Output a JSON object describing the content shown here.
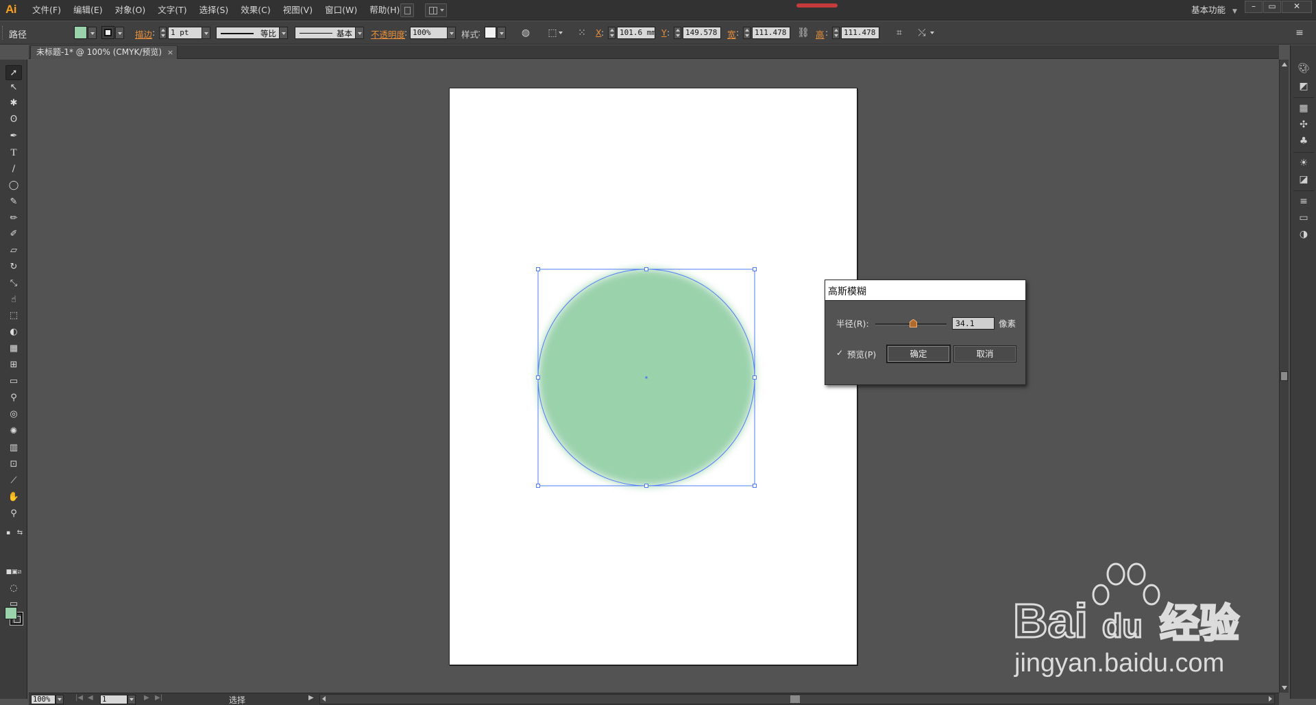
{
  "app": {
    "logo": "Ai"
  },
  "menu": [
    "文件(F)",
    "编辑(E)",
    "对象(O)",
    "文字(T)",
    "选择(S)",
    "效果(C)",
    "视图(V)",
    "窗口(W)",
    "帮助(H)"
  ],
  "workspace": "基本功能",
  "window_controls": {
    "min": "–",
    "max": "▭",
    "close": "✕"
  },
  "control_bar": {
    "selection_type": "路径",
    "stroke_label": "描边",
    "stroke_weight": "1 pt",
    "profile": "等比",
    "brush": "基本",
    "opacity_label": "不透明度",
    "opacity": "100%",
    "style_label": "样式",
    "x_label": "X",
    "x": "101.6 mm",
    "y_label": "Y",
    "y": "149.578",
    "w_label": "宽",
    "w": "111.478",
    "h_label": "高",
    "h": "111.478"
  },
  "document_tab": {
    "title": "未标题-1* @ 100% (CMYK/预览)",
    "close": "×"
  },
  "colors": {
    "fill": "#9ad2ac",
    "selection": "#4f7bf7",
    "accent": "#f7a11e",
    "link_label": "#e8903a"
  },
  "canvas": {
    "object": "ellipse",
    "fill": "#9ad2ac",
    "blur_radius_px": 34.1,
    "selected": true
  },
  "gaussian_blur": {
    "title": "高斯模糊",
    "radius_label": "半径(R):",
    "radius": "34.1",
    "radius_fraction": 0.53,
    "unit": "像素",
    "preview_label": "预览(P)",
    "preview_checked": true,
    "ok": "确定",
    "cancel": "取消"
  },
  "status_bar": {
    "zoom": "100%",
    "artboard": "1",
    "status": "选择"
  },
  "watermark": {
    "brand": "Baidu",
    "brand_cn": "经验",
    "url": "jingyan.baidu.com"
  },
  "tools": [
    "selection-tool",
    "direct-selection-tool",
    "magic-wand-tool",
    "lasso-tool",
    "pen-tool",
    "type-tool",
    "line-segment-tool",
    "ellipse-tool",
    "paintbrush-tool",
    "pencil-tool",
    "blob-brush-tool",
    "eraser-tool",
    "rotate-tool",
    "scale-tool",
    "warp-tool",
    "free-transform-tool",
    "shape-builder-tool",
    "perspective-grid-tool",
    "mesh-tool",
    "gradient-tool",
    "eyedropper-tool",
    "blend-tool",
    "symbol-sprayer-tool",
    "column-graph-tool",
    "artboard-tool",
    "slice-tool",
    "hand-tool",
    "zoom-tool"
  ],
  "dock_panels": [
    "color-panel",
    "color-guide-panel",
    "swatches-panel",
    "brushes-panel",
    "symbols-panel",
    "appearance-panel",
    "graphic-styles-panel",
    "layers-panel",
    "stroke-panel",
    "gradient-panel",
    "transparency-panel"
  ]
}
